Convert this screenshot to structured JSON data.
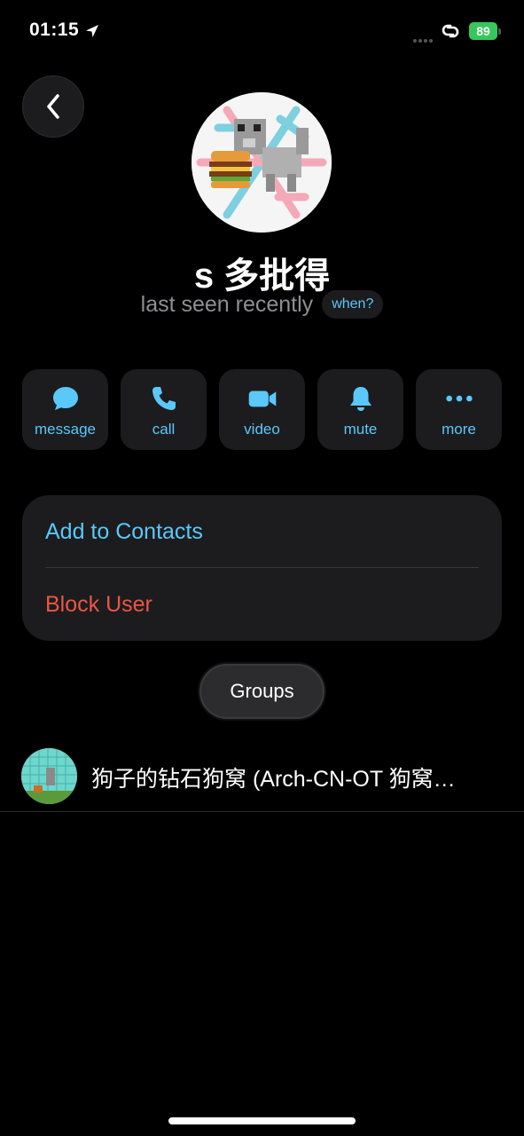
{
  "status_bar": {
    "time": "01:15",
    "battery": "89",
    "icons": [
      "location-arrow-icon",
      "signal-icon",
      "link-icon",
      "battery-icon"
    ]
  },
  "header": {
    "back_icon": "chevron-left-icon"
  },
  "profile": {
    "name": "s 多批得",
    "presence": "last seen recently",
    "when_label": "when?"
  },
  "actions": [
    {
      "label": "message",
      "icon": "message-bubble-icon"
    },
    {
      "label": "call",
      "icon": "phone-icon"
    },
    {
      "label": "video",
      "icon": "video-camera-icon"
    },
    {
      "label": "mute",
      "icon": "bell-icon"
    },
    {
      "label": "more",
      "icon": "ellipsis-icon"
    }
  ],
  "contact_card": {
    "add_label": "Add to Contacts",
    "block_label": "Block User"
  },
  "groups_tab": {
    "label": "Groups"
  },
  "groups": [
    {
      "name": "狗子的钻石狗窝 (Arch-CN-OT 狗窝…"
    }
  ],
  "colors": {
    "accent": "#5ac8fa",
    "destructive": "#eb5545",
    "battery": "#35c75a",
    "card_bg": "#1c1c1e"
  }
}
